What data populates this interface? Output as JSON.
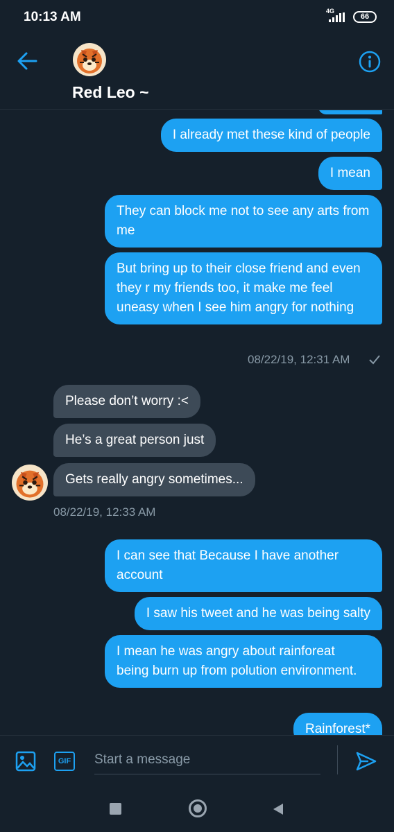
{
  "status_bar": {
    "time": "10:13 AM",
    "network": "4G",
    "battery": "66"
  },
  "header": {
    "contact_name": "Red Leo ~"
  },
  "messages": {
    "sent_1": [
      "I already met these kind of people",
      "I mean",
      "They can block me not to see any arts from me",
      "But bring up to their close friend and even they r my friends too, it make me feel uneasy when I see him angry for nothing"
    ],
    "sent_1_time": "08/22/19, 12:31 AM",
    "received": [
      "Please don’t worry :<",
      "He’s a great person just",
      "Gets really angry sometimes..."
    ],
    "received_time": "08/22/19, 12:33 AM",
    "sent_2": [
      "I can see that Because I have another account",
      "I saw his tweet and he was being salty",
      "I mean he was angry about rainforeat being burn up from polution environment.",
      "Rainforest*"
    ]
  },
  "composer": {
    "placeholder": "Start a message",
    "gif_label": "GIF"
  },
  "colors": {
    "background": "#15202b",
    "sent_bubble": "#1da1f2",
    "received_bubble": "#3d4a57",
    "muted_text": "#8899a6"
  }
}
